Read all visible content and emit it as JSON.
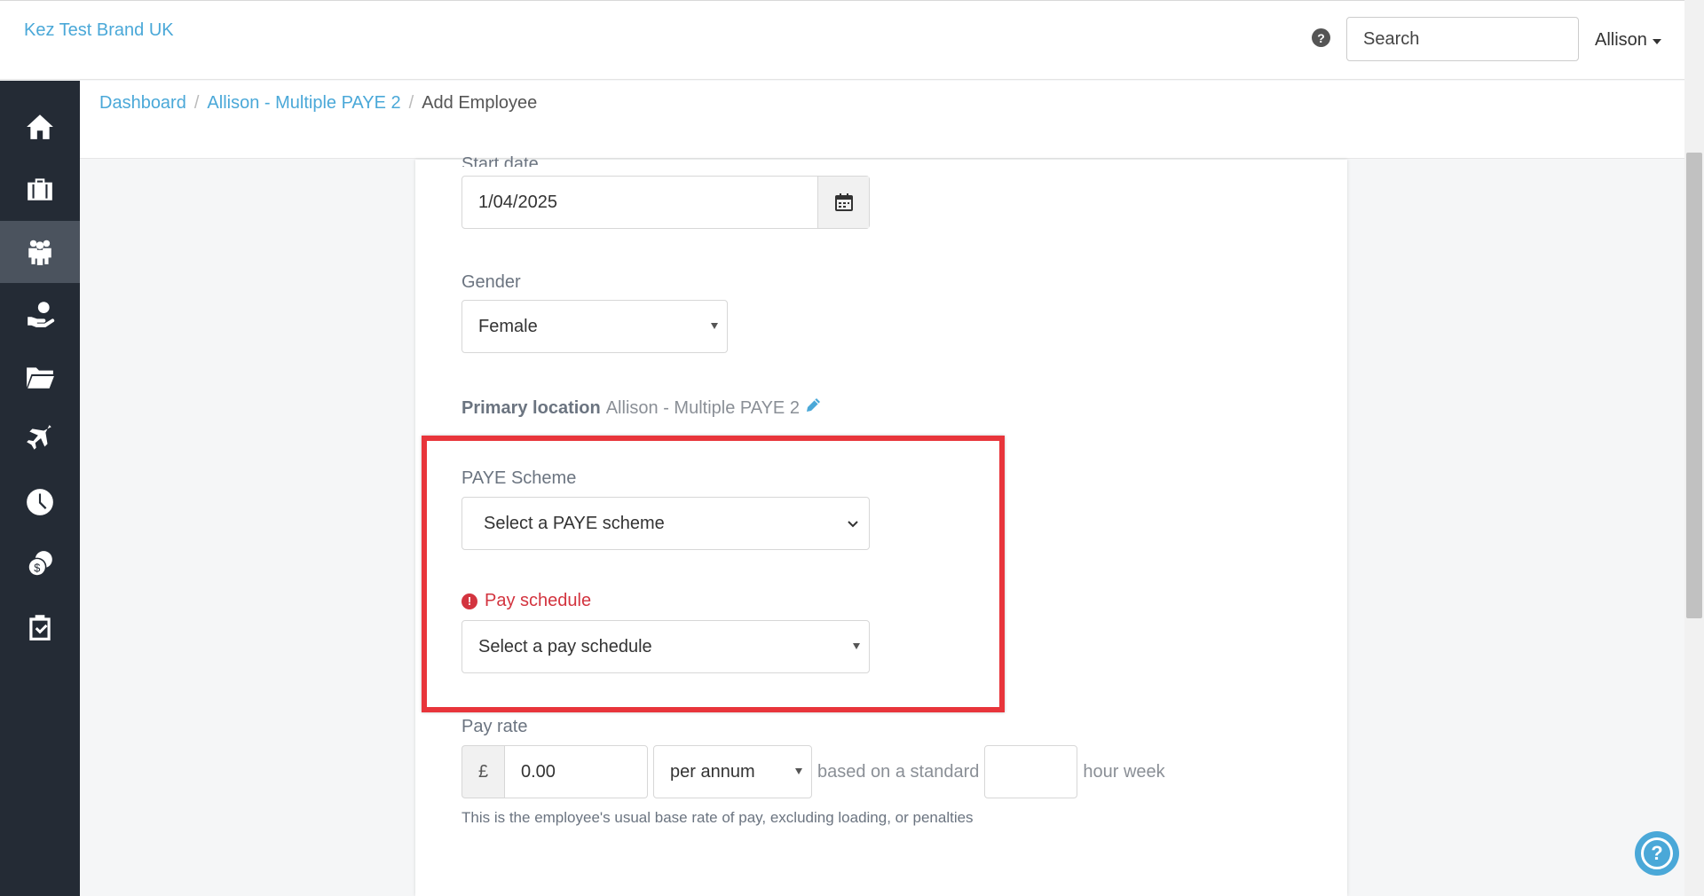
{
  "topbar": {
    "brand": "Kez Test Brand UK",
    "help_icon_glyph": "?",
    "search_placeholder": "Search",
    "user_name": "Allison"
  },
  "sidebar": {
    "items": [
      {
        "icon": "home-icon",
        "active": false
      },
      {
        "icon": "briefcase-icon",
        "active": false
      },
      {
        "icon": "people-icon",
        "active": true
      },
      {
        "icon": "hand-money-icon",
        "active": false
      },
      {
        "icon": "folder-icon",
        "active": false
      },
      {
        "icon": "plane-icon",
        "active": false
      },
      {
        "icon": "clock-icon",
        "active": false
      },
      {
        "icon": "coins-icon",
        "active": false
      },
      {
        "icon": "clipboard-check-icon",
        "active": false
      }
    ]
  },
  "breadcrumb": {
    "items": [
      "Dashboard",
      "Allison - Multiple PAYE 2",
      "Add Employee"
    ],
    "separator": "/"
  },
  "form": {
    "start_date_label": "Start date",
    "start_date_value": "1/04/2025",
    "gender_label": "Gender",
    "gender_value": "Female",
    "primary_location_label": "Primary location",
    "primary_location_value": "Allison - Multiple PAYE 2",
    "paye_label": "PAYE Scheme",
    "paye_placeholder": "Select a PAYE scheme",
    "pay_schedule_label": "Pay schedule",
    "pay_schedule_placeholder": "Select a pay schedule",
    "pay_rate_label": "Pay rate",
    "currency_symbol": "£",
    "pay_amount": "0.00",
    "pay_period": "per annum",
    "standard_text": "based on a standard",
    "hour_week_text": "hour week",
    "pay_rate_hint": "This is the employee's usual base rate of pay, excluding loading, or penalties"
  },
  "colors": {
    "link": "#4aa8d8",
    "sidebar_bg": "#242b35",
    "sidebar_active": "#4b535e",
    "error": "#d3343f",
    "highlight": "#e8353b"
  },
  "help_bubble_glyph": "?"
}
